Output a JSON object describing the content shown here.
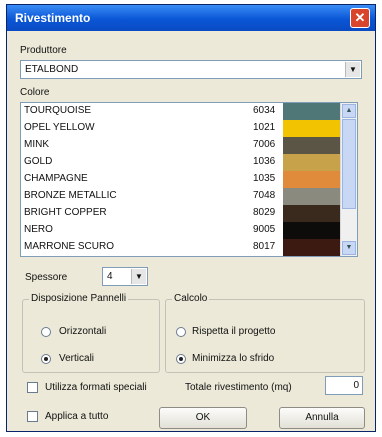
{
  "window": {
    "title": "Rivestimento",
    "close_icon": "close-icon"
  },
  "produttore": {
    "label": "Produttore",
    "value": "ETALBOND"
  },
  "colore": {
    "label": "Colore",
    "items": [
      {
        "name": "TOURQUOISE",
        "code": "6034",
        "color": "#4f7777"
      },
      {
        "name": "OPEL YELLOW",
        "code": "1021",
        "color": "#f2c300"
      },
      {
        "name": "MINK",
        "code": "7006",
        "color": "#5b5545"
      },
      {
        "name": "GOLD",
        "code": "1036",
        "color": "#c8a24a"
      },
      {
        "name": "CHAMPAGNE",
        "code": "1035",
        "color": "#e08a3c"
      },
      {
        "name": "BRONZE METALLIC",
        "code": "7048",
        "color": "#8a8a7e"
      },
      {
        "name": "BRIGHT COPPER",
        "code": "8029",
        "color": "#3a2a1e"
      },
      {
        "name": "NERO",
        "code": "9005",
        "color": "#0e0c0b"
      },
      {
        "name": "MARRONE SCURO",
        "code": "8017",
        "color": "#3c1a12"
      }
    ]
  },
  "spessore": {
    "label": "Spessore",
    "value": "4"
  },
  "disposizione": {
    "title": "Disposizione Pannelli",
    "orizzontali": "Orizzontali",
    "verticali": "Verticali"
  },
  "calcolo": {
    "title": "Calcolo",
    "rispetta": "Rispetta il progetto",
    "minimizza": "Minimizza lo sfrido"
  },
  "utilizza_label": "Utilizza formati speciali",
  "totale": {
    "label": "Totale rivestimento (mq)",
    "value": "0"
  },
  "applica_label": "Applica a tutto",
  "buttons": {
    "ok": "OK",
    "annulla": "Annulla"
  }
}
